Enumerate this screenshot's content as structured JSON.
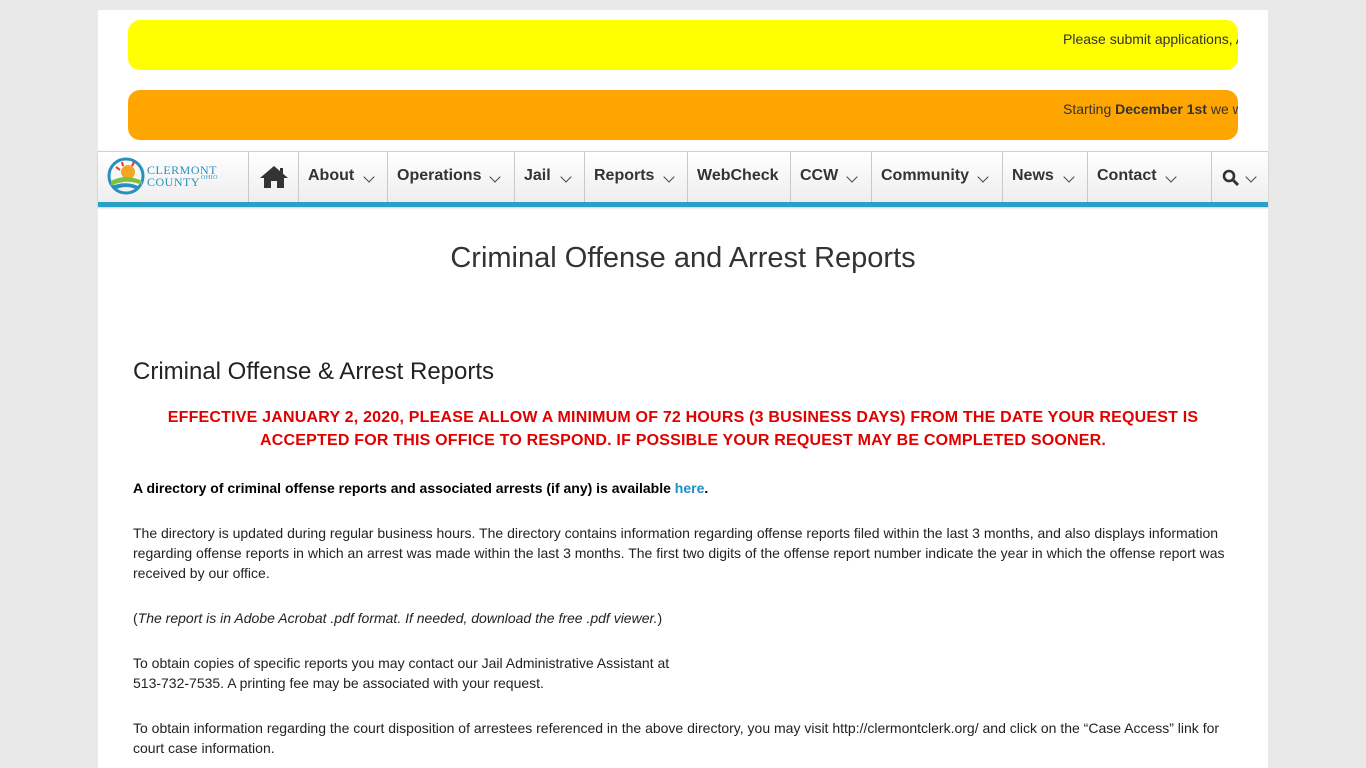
{
  "tickers": [
    {
      "text": "Please submit applications, A",
      "color": "#ffff00"
    },
    {
      "text_prefix": "Starting ",
      "text_bold": "December 1st",
      "text_suffix": " we w",
      "color": "#ffa500"
    }
  ],
  "logo": {
    "line1": "CLERMONT",
    "line2": "COUNTY",
    "line3": "OHIO"
  },
  "nav": {
    "items": [
      {
        "label": "About",
        "dropdown": true
      },
      {
        "label": "Operations",
        "dropdown": true
      },
      {
        "label": "Jail",
        "dropdown": true
      },
      {
        "label": "Reports",
        "dropdown": true
      },
      {
        "label": "WebCheck",
        "dropdown": false
      },
      {
        "label": "CCW",
        "dropdown": true
      },
      {
        "label": "Community",
        "dropdown": true
      },
      {
        "label": "News",
        "dropdown": true
      },
      {
        "label": "Contact",
        "dropdown": true
      }
    ],
    "accent": "#2aa0c7"
  },
  "page_title": "Criminal Offense and Arrest Reports",
  "section_title": "Criminal Offense & Arrest Reports",
  "alert": "EFFECTIVE JANUARY 2, 2020, PLEASE ALLOW A MINIMUM OF 72 HOURS (3 BUSINESS DAYS) FROM THE DATE YOUR REQUEST IS ACCEPTED FOR THIS OFFICE TO RESPOND. IF POSSIBLE YOUR REQUEST MAY BE COMPLETED SOONER.",
  "directory": {
    "text": "A directory of criminal offense reports and associated arrests (if any) is available ",
    "link": "here",
    "end": "."
  },
  "para_update": "The directory is updated during regular business hours. The directory contains information regarding offense reports filed within the last 3 months, and also displays information regarding offense reports in which an arrest was made within the last 3 months. The first two digits of the offense report number indicate the year in which the offense report was received by our office.",
  "para_pdf": {
    "open": "(",
    "text": "The report is in Adobe Acrobat .pdf format. If needed, download the free .pdf viewer.",
    "close": ")"
  },
  "para_copies": {
    "line1": "To obtain copies of specific reports you may contact our Jail Administrative Assistant at",
    "line2": "513-732-7535. A printing fee may be associated with your request."
  },
  "para_court": "To obtain information regarding the court disposition of arrestees referenced in the above directory, you may visit http://clermontclerk.org/ and click on the “Case Access” link for court case information."
}
